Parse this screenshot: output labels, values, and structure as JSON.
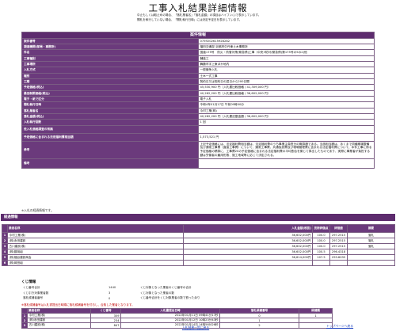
{
  "page": {
    "title": "工事入札結果詳細情報",
    "notice_lines": [
      "中止もしくは取止めの場合、「落札業者名」「落札金額」の項目はハイフン(-)で表示しています。",
      "開札を執行していない場合、「開札執行日時」には決定予定日を表示しています。"
    ]
  },
  "case_info": {
    "header": "案件情報",
    "rows": [
      {
        "label": "案件番号",
        "value": "0759202615928282"
      },
      {
        "label": "調達機関(部局・事務所)",
        "value": "福田交通部 京都府中丹東土木事務所"
      },
      {
        "label": "件名",
        "value": "国道175号　防災・防雪対策(緊急債)工事（中央3防対(緊急債)第175号の5の2)他"
      },
      {
        "label": "工事種別",
        "value": "舗装工"
      },
      {
        "label": "工事場所",
        "value": "舞鶴市字上東ほか地内"
      },
      {
        "label": "入札方式",
        "value": "一般競争入札"
      },
      {
        "label": "種別",
        "value": "土木一式工事"
      },
      {
        "label": "工期",
        "value": "契約日又は契約日の翌日から200日間"
      },
      {
        "label": "予定価格(税込)",
        "value": "45,530,900 円（入札書比較価格 / 41,309,000 円）"
      },
      {
        "label": "最低制限価格(税込)",
        "value": "40,262,200 円（入札書比較価格 / 36,602,000 円）"
      },
      {
        "label": "電子・紙で区分",
        "value": "電子入札"
      },
      {
        "label": "開札執行日時",
        "value": "令和4年01月17日 午前09時00分"
      },
      {
        "label": "落札業者名",
        "value": "今村工業(株)"
      },
      {
        "label": "落札金額(税込)",
        "value": "40,262,200 円（入札書記載金額 / 36,602,000 円）"
      },
      {
        "label": "入札執行回数",
        "value": "1 回"
      },
      {
        "label": "低入札価格調査の有無",
        "value": ""
      },
      {
        "label": "予定価格に含まれる法定福利費相当額",
        "value": "1,573,521 円"
      },
      {
        "label": "参考",
        "value": "上記予定価格には、法定福利費相当額は、法定福利費のうち事業主負担分の概算額である。当該相当額は、あくまで同種期場整備及び通常工事費（直接工事費）について、通常工事費、共通仮設費及び現場管理費に含まれる法定福利費について、本件工事に係る予定価格の積算に、工事費20の予定価格に含まれる法定福利費の平均割合を乗じて算出したものであり、実際に事業者が負担する額は労働者の雇用形態、施工地域等に応じて決定される。"
      },
      {
        "label": "備考",
        "value": ""
      }
    ]
  },
  "bid_section": {
    "note": "※入札の経過情報です。",
    "header": "経過情報",
    "columns": [
      "業者名称",
      "入札金額(税抜)",
      "技術評価点",
      "評価値",
      "摘要"
    ],
    "rows": [
      {
        "no": "1",
        "name": "今村工業(株)",
        "amount": "36,602,000円",
        "tech": "100.0",
        "eval": "297.2515",
        "note": "落札"
      },
      {
        "no": "2",
        "name": "(株)永田建設",
        "amount": "36,602,000円",
        "tech": "100.0",
        "eval": "297.2515",
        "note": "落札"
      },
      {
        "no": "3",
        "name": "古川建設(株)",
        "amount": "36,602,000円",
        "tech": "100.0",
        "eval": "297.2515",
        "note": "落札"
      },
      {
        "no": "4",
        "name": "(株)藤岡組",
        "amount": "36,602,000円",
        "tech": "100.5",
        "eval": "296.4318",
        "note": ""
      },
      {
        "no": "5",
        "name": "(株)福谷建設商会",
        "amount": "36,614,000円",
        "tech": "107.5",
        "eval": "293.6035",
        "note": ""
      },
      {
        "no": "6",
        "name": "(株)岡田組",
        "amount": "",
        "tech": "",
        "eval": "",
        "note": ""
      }
    ]
  },
  "kuji": {
    "title": "くじ情報",
    "info": [
      {
        "label": "くじ番号合計",
        "value": "1440",
        "desc": "くじ対象となった業者のくじ番号の合計"
      },
      {
        "label": "くじ引き対象業者数",
        "value": "3",
        "desc": "くじ対象となった業者の数"
      },
      {
        "label": "落札候補者番号",
        "value": "0",
        "desc": "くじ番号合計をくじ対象業者の数で割った余り"
      }
    ],
    "warning": "※落札候補番号は入札書提出日時順に落札候補番号を付与し、合致した業者となります。",
    "columns": [
      "業者名称",
      "くじ番号",
      "入札書提出日時",
      "落札候補番号",
      "候補順"
    ],
    "rows": [
      {
        "no": "1",
        "name": "今村工業(株)",
        "num": "359",
        "time": "2022年01月11日 09時41分17秒",
        "cand": "0",
        "order": "1"
      },
      {
        "no": "2",
        "name": "(株)永田建設",
        "num": "234",
        "time": "2022年01月12日 10時23分43秒",
        "cand": "1",
        "order": ""
      },
      {
        "no": "3",
        "name": "古川建設(株)",
        "num": "847",
        "time": "2022年01月14日 14時56分26秒",
        "cand": "2",
        "order": ""
      }
    ]
  },
  "links": {
    "back": "入札結果一覧に戻る",
    "top": "トップページへ戻る"
  }
}
